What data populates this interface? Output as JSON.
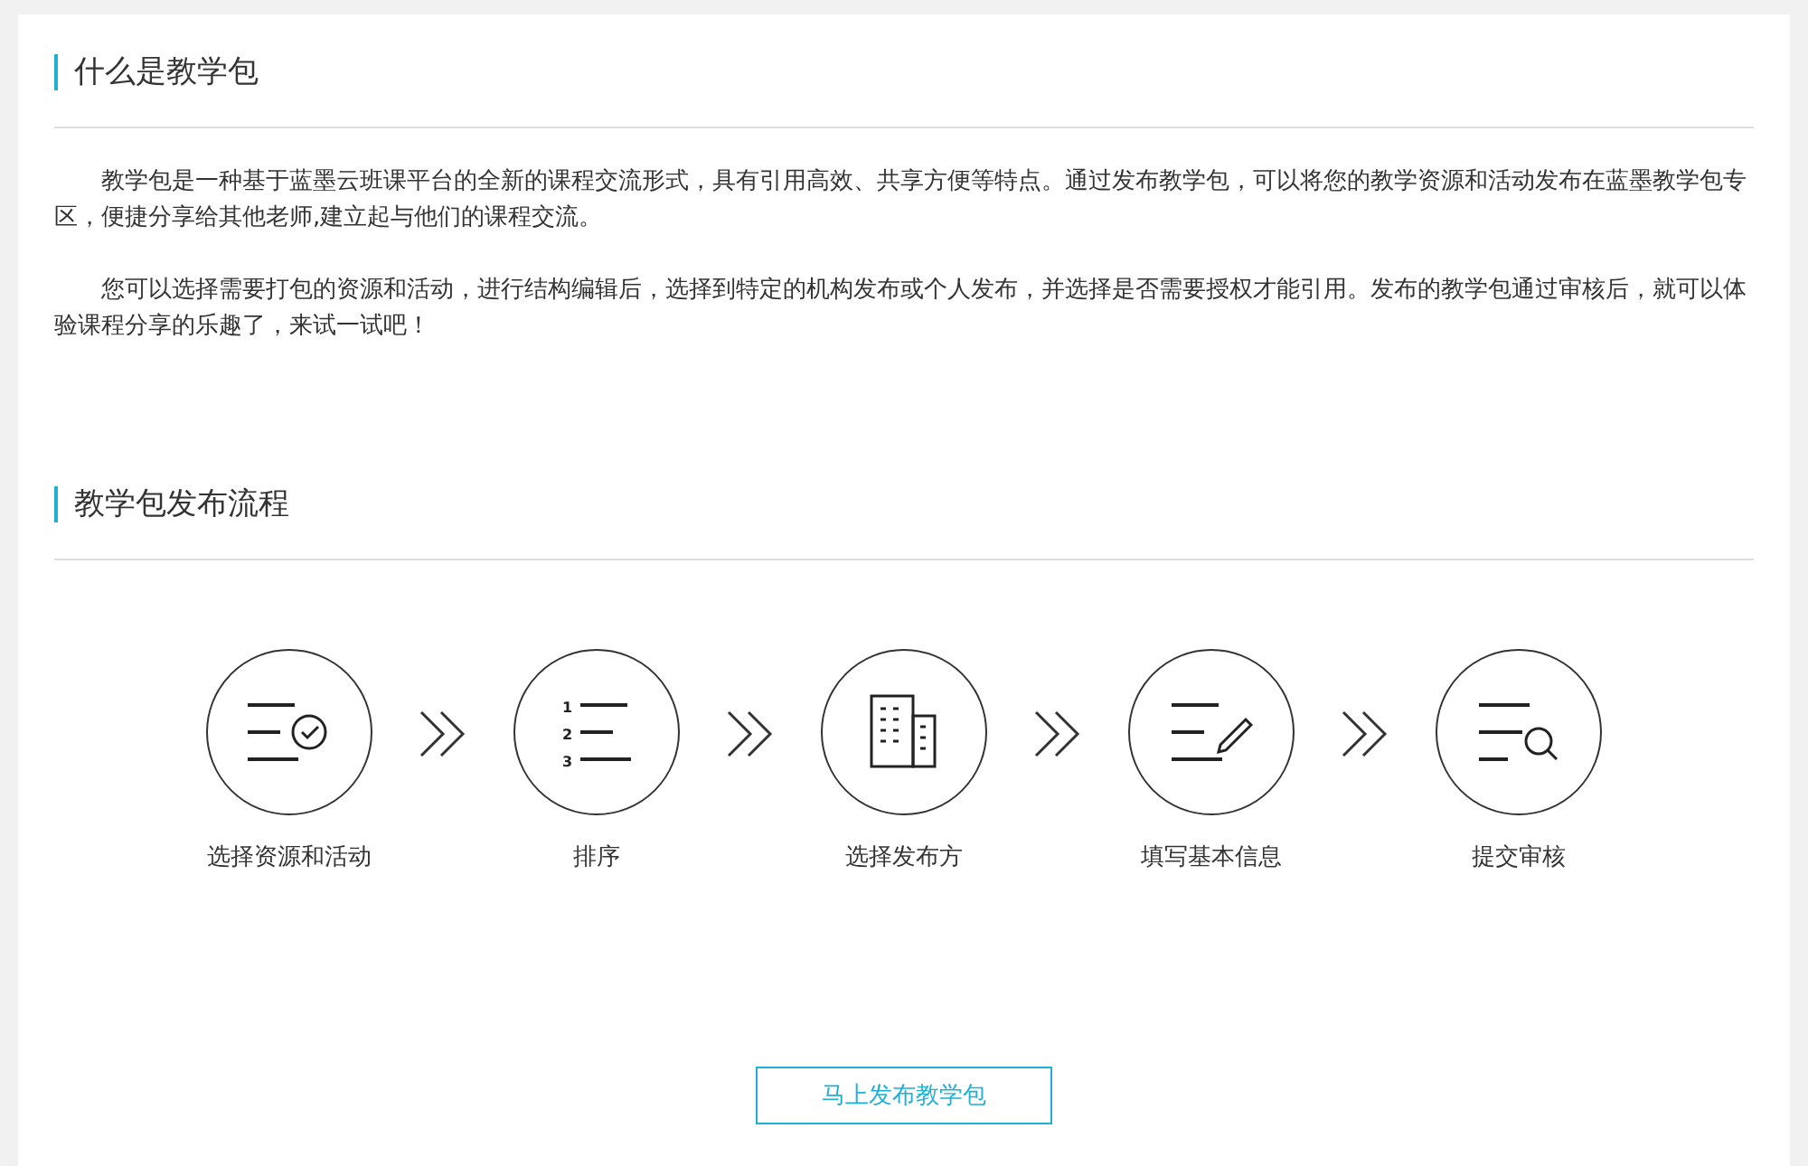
{
  "sections": [
    {
      "title": "什么是教学包",
      "paragraphs": [
        "教学包是一种基于蓝墨云班课平台的全新的课程交流形式，具有引用高效、共享方便等特点。通过发布教学包，可以将您的教学资源和活动发布在蓝墨教学包专区，便捷分享给其他老师,建立起与他们的课程交流。",
        "您可以选择需要打包的资源和活动，进行结构编辑后，选择到特定的机构发布或个人发布，并选择是否需要授权才能引用。发布的教学包通过审核后，就可以体验课程分享的乐趣了，来试一试吧！"
      ]
    },
    {
      "title": "教学包发布流程"
    }
  ],
  "steps": [
    {
      "kind": "check-list",
      "label": "选择资源和活动"
    },
    {
      "kind": "numbered-list",
      "label": "排序",
      "numbers": [
        "1",
        "2",
        "3"
      ]
    },
    {
      "kind": "buildings",
      "label": "选择发布方"
    },
    {
      "kind": "edit-list",
      "label": "填写基本信息"
    },
    {
      "kind": "search-list",
      "label": "提交审核"
    }
  ],
  "button": "马上发布教学包"
}
